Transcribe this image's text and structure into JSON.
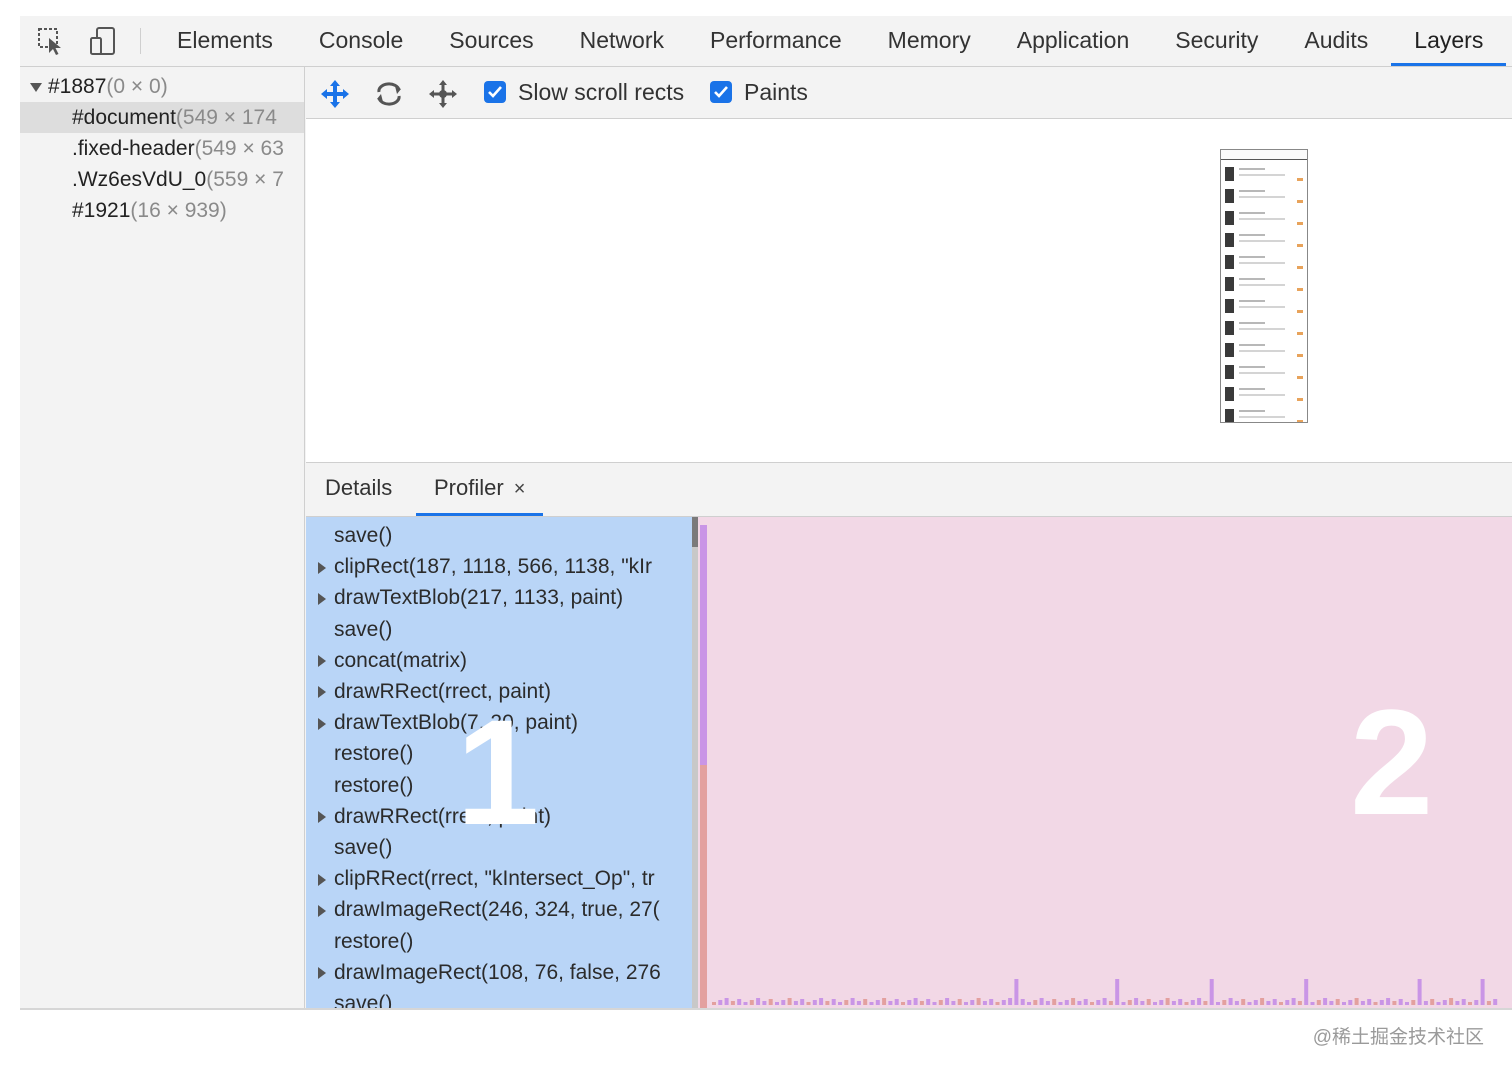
{
  "toolbar": {
    "inspect_icon": "inspect-element-icon",
    "device_icon": "device-toolbar-icon"
  },
  "tabs": [
    {
      "label": "Elements"
    },
    {
      "label": "Console"
    },
    {
      "label": "Sources"
    },
    {
      "label": "Network"
    },
    {
      "label": "Performance"
    },
    {
      "label": "Memory"
    },
    {
      "label": "Application"
    },
    {
      "label": "Security"
    },
    {
      "label": "Audits"
    },
    {
      "label": "Layers",
      "active": true
    }
  ],
  "layer_tree": [
    {
      "name": "#1887",
      "size": "(0 × 0)",
      "expanded": true
    },
    {
      "name": "#document",
      "size": "(549 × 174",
      "selected": true
    },
    {
      "name": ".fixed-header",
      "size": "(549 × 63"
    },
    {
      "name": ".Wz6esVdU_0",
      "size": "(559 × 7"
    },
    {
      "name": "#1921",
      "size": "(16 × 939)"
    }
  ],
  "layers_toolbar": {
    "pan_icon": "pan-mode-icon",
    "rotate_icon": "rotate-mode-icon",
    "reset_icon": "reset-transform-icon",
    "slow_scroll_label": "Slow scroll rects",
    "slow_scroll_checked": true,
    "paints_label": "Paints",
    "paints_checked": true
  },
  "subtabs": {
    "details": "Details",
    "profiler": "Profiler",
    "close": "×"
  },
  "commands": [
    {
      "text": "save()",
      "expandable": false
    },
    {
      "text": "clipRect(187, 1118, 566, 1138, \"kIr",
      "expandable": true
    },
    {
      "text": "drawTextBlob(217, 1133, paint)",
      "expandable": true
    },
    {
      "text": "save()",
      "expandable": false
    },
    {
      "text": "concat(matrix)",
      "expandable": true
    },
    {
      "text": "drawRRect(rrect, paint)",
      "expandable": true
    },
    {
      "text": "drawTextBlob(7, 20, paint)",
      "expandable": true
    },
    {
      "text": "restore()",
      "expandable": false
    },
    {
      "text": "restore()",
      "expandable": false
    },
    {
      "text": "drawRRect(rrect, paint)",
      "expandable": true
    },
    {
      "text": "save()",
      "expandable": false
    },
    {
      "text": "clipRRect(rrect, \"kIntersect_Op\", tr",
      "expandable": true
    },
    {
      "text": "drawImageRect(246, 324, true, 27(",
      "expandable": true
    },
    {
      "text": "restore()",
      "expandable": false
    },
    {
      "text": "drawImageRect(108, 76, false, 276",
      "expandable": true
    },
    {
      "text": "save()",
      "expandable": false
    }
  ],
  "overlay": {
    "mark_1": "1",
    "mark_2": "2"
  },
  "watermark": "@稀土掘金技术社区",
  "colors": {
    "accent": "#1a73e8",
    "command_bg": "#b9d5f7",
    "timeline_bg": "#f2d8e6",
    "bar_purple": "#c995e6",
    "bar_red": "#e3a09f"
  }
}
